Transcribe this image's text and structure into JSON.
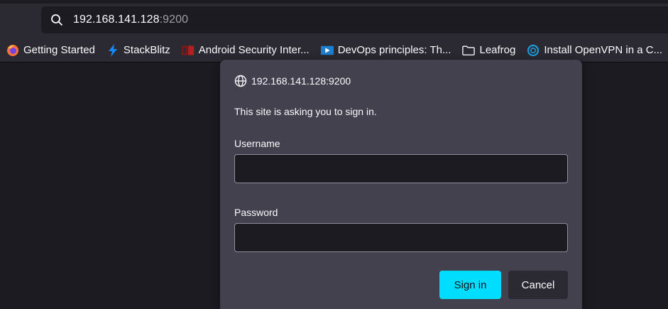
{
  "urlbar": {
    "host": "192.168.141.128",
    "port": ":9200",
    "search_icon": "search-icon"
  },
  "bookmarks": [
    {
      "label": "Getting Started",
      "icon": "firefox-icon"
    },
    {
      "label": "StackBlitz",
      "icon": "stackblitz-bolt-icon"
    },
    {
      "label": "Android Security Inter...",
      "icon": "android-security-icon"
    },
    {
      "label": "DevOps principles: Th...",
      "icon": "video-icon"
    },
    {
      "label": "Leafrog",
      "icon": "folder-icon"
    },
    {
      "label": "Install OpenVPN in a C...",
      "icon": "openvpn-icon"
    }
  ],
  "dialog": {
    "origin": "192.168.141.128:9200",
    "message": "This site is asking you to sign in.",
    "username_label": "Username",
    "username_value": "",
    "password_label": "Password",
    "password_value": "",
    "sign_in_label": "Sign in",
    "cancel_label": "Cancel"
  },
  "colors": {
    "accent": "#00ddff",
    "background": "#1c1b22",
    "toolbar": "#2b2a33",
    "dialog": "#42414d"
  }
}
